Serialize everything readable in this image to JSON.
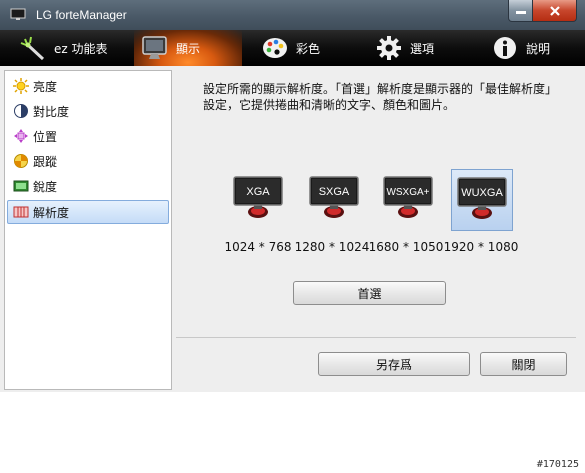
{
  "window": {
    "title": "LG forteManager"
  },
  "toolbar": {
    "items": [
      {
        "label": "ez 功能表",
        "icon": "magic-wand-icon"
      },
      {
        "label": "顯示",
        "icon": "monitor-icon",
        "active": true
      },
      {
        "label": "彩色",
        "icon": "palette-icon"
      },
      {
        "label": "選項",
        "icon": "gear-icon"
      },
      {
        "label": "說明",
        "icon": "info-icon"
      }
    ]
  },
  "sidebar": {
    "items": [
      {
        "label": "亮度",
        "icon": "brightness-icon"
      },
      {
        "label": "對比度",
        "icon": "contrast-icon"
      },
      {
        "label": "位置",
        "icon": "position-icon"
      },
      {
        "label": "跟蹤",
        "icon": "tracking-icon"
      },
      {
        "label": "銳度",
        "icon": "sharpness-icon"
      },
      {
        "label": "解析度",
        "icon": "resolution-icon",
        "selected": true
      }
    ]
  },
  "main": {
    "description": "設定所需的顯示解析度。「首選」解析度是顯示器的「最佳解析度」設定，它提供捲曲和清晰的文字、顏色和圖片。",
    "resolutions": [
      {
        "name": "XGA",
        "size": "1024 * 768"
      },
      {
        "name": "SXGA",
        "size": "1280 * 1024"
      },
      {
        "name": "WSXGA+",
        "size": "1680 * 1050"
      },
      {
        "name": "WUXGA",
        "size": "1920 * 1080",
        "selected": true
      }
    ],
    "preferred_button": "首選"
  },
  "footer": {
    "save_as": "另存爲",
    "close": "關閉"
  },
  "watermark": "#170125",
  "colors": {
    "accent_orange": "#e06a14",
    "selection_blue": "#c5dcf7",
    "close_red": "#c7462c"
  }
}
